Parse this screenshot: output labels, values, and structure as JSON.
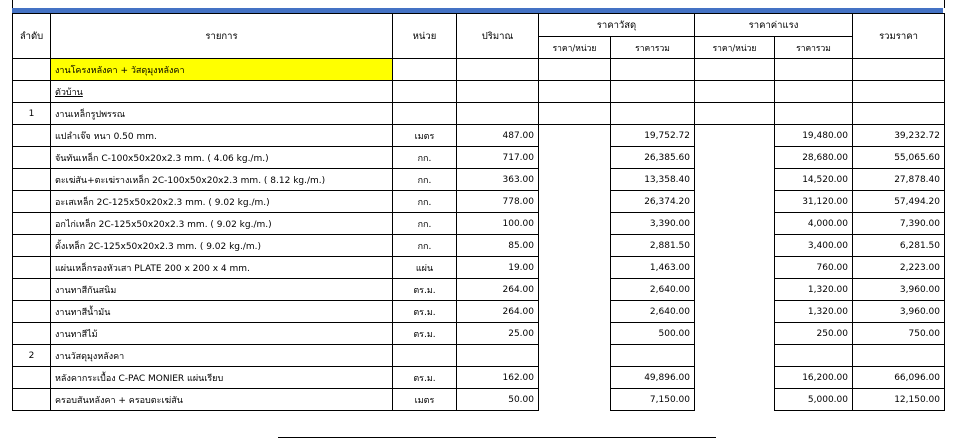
{
  "header": {
    "col_no": "ลำดับ",
    "col_item": "รายการ",
    "col_unit": "หน่วย",
    "col_qty": "ปริมาณ",
    "material_group": "ราคาวัสดุ",
    "labor_group": "ราคาค่าแรง",
    "col_total": "รวมราคา",
    "unit_price": "ราคา/หน่วย",
    "total_price": "ราคารวม"
  },
  "rows": [
    {
      "no": "",
      "item": "งานโครงหลังคา + วัสดุมุงหลังคา",
      "unit": "",
      "qty": "",
      "mat_unit": "",
      "mat_total": "",
      "lab_unit": "",
      "lab_total": "",
      "total": ""
    },
    {
      "no": "",
      "item": "ตัวบ้าน",
      "unit": "",
      "qty": "",
      "mat_unit": "",
      "mat_total": "",
      "lab_unit": "",
      "lab_total": "",
      "total": ""
    },
    {
      "no": "1",
      "item": "งานเหล็กรูปพรรณ",
      "unit": "",
      "qty": "",
      "mat_unit": "",
      "mat_total": "",
      "lab_unit": "",
      "lab_total": "",
      "total": ""
    },
    {
      "no": "",
      "item": "แปลำเจ๊จ หนา 0.50 mm.",
      "unit": "เมตร",
      "qty": "487.00",
      "mat_unit": "",
      "mat_total": "19,752.72",
      "lab_unit": "",
      "lab_total": "19,480.00",
      "total": "39,232.72"
    },
    {
      "no": "",
      "item": "จันทันเหล็ก C-100x50x20x2.3 mm. ( 4.06 kg./m.)",
      "unit": "กก.",
      "qty": "717.00",
      "mat_unit": "",
      "mat_total": "26,385.60",
      "lab_unit": "",
      "lab_total": "28,680.00",
      "total": "55,065.60"
    },
    {
      "no": "",
      "item": "ตะเฆ่สัน+ตะเฆ่รางเหล็ก 2C-100x50x20x2.3 mm. ( 8.12 kg./m.)",
      "unit": "กก.",
      "qty": "363.00",
      "mat_unit": "",
      "mat_total": "13,358.40",
      "lab_unit": "",
      "lab_total": "14,520.00",
      "total": "27,878.40"
    },
    {
      "no": "",
      "item": "อะเสเหล็ก 2C-125x50x20x2.3 mm. ( 9.02 kg./m.)",
      "unit": "กก.",
      "qty": "778.00",
      "mat_unit": "",
      "mat_total": "26,374.20",
      "lab_unit": "",
      "lab_total": "31,120.00",
      "total": "57,494.20"
    },
    {
      "no": "",
      "item": "อกไก่เหล็ก 2C-125x50x20x2.3 mm. ( 9.02 kg./m.)",
      "unit": "กก.",
      "qty": "100.00",
      "mat_unit": "",
      "mat_total": "3,390.00",
      "lab_unit": "",
      "lab_total": "4,000.00",
      "total": "7,390.00"
    },
    {
      "no": "",
      "item": "ดั้งเหล็ก 2C-125x50x20x2.3 mm. ( 9.02 kg./m.)",
      "unit": "กก.",
      "qty": "85.00",
      "mat_unit": "",
      "mat_total": "2,881.50",
      "lab_unit": "",
      "lab_total": "3,400.00",
      "total": "6,281.50"
    },
    {
      "no": "",
      "item": "แผ่นเหล็กรองหัวเสา PLATE 200 x 200 x 4 mm.",
      "unit": "แผ่น",
      "qty": "19.00",
      "mat_unit": "",
      "mat_total": "1,463.00",
      "lab_unit": "",
      "lab_total": "760.00",
      "total": "2,223.00"
    },
    {
      "no": "",
      "item": "งานทาสีกันสนิม",
      "unit": "ตร.ม.",
      "qty": "264.00",
      "mat_unit": "",
      "mat_total": "2,640.00",
      "lab_unit": "",
      "lab_total": "1,320.00",
      "total": "3,960.00"
    },
    {
      "no": "",
      "item": "งานทาสีน้ำมัน",
      "unit": "ตร.ม.",
      "qty": "264.00",
      "mat_unit": "",
      "mat_total": "2,640.00",
      "lab_unit": "",
      "lab_total": "1,320.00",
      "total": "3,960.00"
    },
    {
      "no": "",
      "item": "งานทาสีไม้",
      "unit": "ตร.ม.",
      "qty": "25.00",
      "mat_unit": "",
      "mat_total": "500.00",
      "lab_unit": "",
      "lab_total": "250.00",
      "total": "750.00"
    },
    {
      "no": "2",
      "item": "งานวัสดุมุงหลังคา",
      "unit": "",
      "qty": "",
      "mat_unit": "",
      "mat_total": "",
      "lab_unit": "",
      "lab_total": "",
      "total": ""
    },
    {
      "no": "",
      "item": "หลังคากระเบื้อง C-PAC MONIER แผ่นเรียบ",
      "unit": "ตร.ม.",
      "qty": "162.00",
      "mat_unit": "",
      "mat_total": "49,896.00",
      "lab_unit": "",
      "lab_total": "16,200.00",
      "total": "66,096.00"
    },
    {
      "no": "",
      "item": "ครอบสันหลังคา + ครอบตะเฆ่สัน",
      "unit": "เมตร",
      "qty": "50.00",
      "mat_unit": "",
      "mat_total": "7,150.00",
      "lab_unit": "",
      "lab_total": "5,000.00",
      "total": "12,150.00"
    }
  ],
  "colors": {
    "accent_bar": "#4472c4",
    "highlight": "#ffff00"
  }
}
